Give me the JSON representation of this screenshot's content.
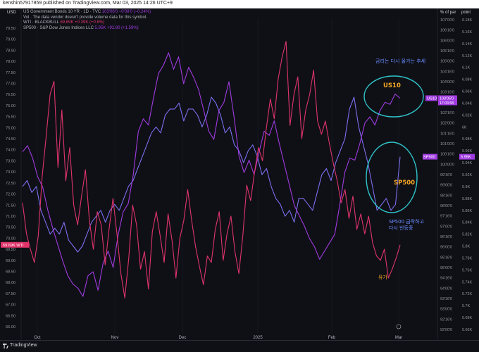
{
  "header": {
    "published_text": "kenshin57917859 published on TradingView.com, Mar 03, 2025 14:26 UTC+9",
    "left_axis_unit": "USD",
    "mid_axis_unit": "% of par",
    "right_axis_unit": "point"
  },
  "legend": {
    "line1_name": "US Government Bonds 10 YR · 1D · TVC",
    "line1_values": "103'06'0  −0'08'0 (−0.24%)",
    "line2": "Vol · The data vendor doesn't provide volume data for this symbol.",
    "line3_name": "WTI · BLACKBULL",
    "line3_values": "69.69K  +0.39K (+0.6%)",
    "line4_name": "SP500 · S&P Dow Jones Indices LLC",
    "line4_values": "5.95K  +92.80 (+1.59%)"
  },
  "footer": {
    "brand": "TradingView"
  },
  "colors": {
    "wti": "#e0346b",
    "us10": "#a03be0",
    "sp500": "#7b6ff0",
    "annotation_teal": "#2ec4c9",
    "annotation_orange": "#f5a623",
    "annotation_blue": "#6a8cff"
  },
  "chart_data": {
    "type": "line",
    "x_tick_labels": [
      "Oct",
      "Nov",
      "Dec",
      "2025",
      "Feb",
      "Mar"
    ],
    "left_axis": {
      "unit": "USD",
      "ylim": [
        66.0,
        79.5
      ],
      "ticks": [
        "79.50",
        "79.00",
        "78.50",
        "78.00",
        "77.50",
        "77.00",
        "76.50",
        "76.00",
        "75.50",
        "75.00",
        "74.50",
        "74.00",
        "73.50",
        "73.00",
        "72.50",
        "72.00",
        "71.50",
        "71.00",
        "70.50",
        "70.00",
        "69.50",
        "69.00",
        "68.50",
        "68.00",
        "67.50",
        "67.00",
        "66.50",
        "66.00"
      ]
    },
    "mid_axis": {
      "unit": "% of par",
      "ticks": [
        "107'00'0",
        "106'16'0",
        "106'00'0",
        "105'16'0",
        "105'00'0",
        "104'16'0",
        "104'00'0",
        "103'16'0",
        "103'00'0",
        "102'16'0",
        "102'00'0",
        "101'16'0",
        "101'00'0",
        "100'16'0",
        "100'00'0",
        "99'16'0",
        "99'00'0",
        "98'16'0",
        "98'00'0",
        "97'16'0",
        "97'00'0",
        "96'16'0",
        "96'00'0",
        "95'16'0",
        "95'00'0",
        "94'16'0",
        "94'00'0",
        "93'16'0",
        "93'00'0",
        "92'16'0",
        "92'00'0"
      ]
    },
    "right_axis": {
      "unit": "point",
      "ylim": [
        5.66,
        6.18
      ],
      "ticks": [
        "6.18K",
        "6.16K",
        "6.14K",
        "6.12K",
        "6.1K",
        "6.08K",
        "6.06K",
        "6.04K",
        "6.02K",
        "6K",
        "5.98K",
        "5.96K",
        "5.94K",
        "5.92K",
        "5.9K",
        "5.88K",
        "5.86K",
        "5.84K",
        "5.82K",
        "5.8K",
        "5.78K",
        "5.76K",
        "5.74K",
        "5.72K",
        "5.7K",
        "5.68K",
        "5.66K"
      ]
    },
    "price_labels": {
      "wti": "69.69K  WTI",
      "us10": "US10",
      "us10_price": "103'05'0",
      "us10_time": "17:03:58",
      "sp500": "SP500",
      "sp500_price": "5.95K"
    },
    "series": [
      {
        "name": "WTI",
        "axis": "left",
        "values": [
          71.6,
          70.2,
          69.5,
          68.9,
          70.1,
          72.8,
          74.6,
          76.5,
          77.1,
          73.2,
          75.8,
          72.6,
          74.1,
          71.5,
          70.6,
          71.9,
          73.1,
          70.8,
          69.5,
          71.2,
          70.6,
          68.8,
          70.4,
          71.8,
          70.2,
          68.4,
          67.3,
          69.1,
          71.5,
          70.6,
          68.6,
          69.4,
          67.7,
          70.3,
          71.2,
          70.1,
          68.9,
          71.1,
          69.9,
          68.2,
          70.0,
          70.8,
          72.2,
          70.8,
          69.6,
          68.7,
          67.9,
          69.2,
          68.9,
          70.4,
          71.2,
          69.0,
          70.2,
          71.0,
          69.4,
          68.4,
          70.1,
          72.4,
          71.7,
          73.0,
          74.1,
          73.5,
          75.0,
          76.3,
          75.4,
          77.2,
          78.2,
          78.9,
          75.1,
          76.5,
          77.3,
          74.5,
          75.8,
          76.5,
          77.6,
          75.3,
          74.7,
          75.3,
          74.3,
          73.4,
          72.6,
          71.6,
          72.2,
          70.9,
          71.9,
          70.4,
          71.1,
          70.2,
          71.0,
          69.8,
          69.2,
          69.0,
          69.5,
          68.2,
          68.6,
          69.1,
          69.7
        ],
        "note": "approximate daily closes, Sep 2024 – Mar 03 2025"
      },
      {
        "name": "US10",
        "axis": "mid",
        "values_pct_of_par": [
          100.6,
          100.9,
          100.3,
          99.4,
          98.9,
          97.8,
          96.9,
          96.1,
          95.3,
          94.6,
          94.2,
          94.0,
          93.6,
          94.6,
          94.8,
          93.9,
          95.2,
          95.8,
          95.0,
          96.6,
          97.7,
          98.1,
          99.5,
          101.6,
          102.2,
          101.9,
          103.2,
          104.4,
          104.8,
          105.4,
          104.6,
          105.2,
          103.9,
          104.7,
          104.2,
          103.6,
          102.6,
          101.6,
          101.2,
          102.6,
          103.0,
          104.0,
          102.3,
          100.4,
          99.6,
          100.2,
          99.5,
          100.6,
          101.6,
          101.4,
          102.1,
          101.0,
          100.0,
          99.0,
          98.0,
          97.5,
          97.0,
          96.4,
          96.0,
          95.4,
          95.8,
          96.2,
          96.6,
          98.0,
          99.6,
          100.3,
          100.2,
          101.0,
          102.0,
          102.3,
          101.9,
          102.6,
          103.0,
          102.9,
          103.4,
          103.2
        ],
        "note": "approximate daily closes, Sep 2024 – Mar 03 2025"
      },
      {
        "name": "SP500",
        "axis": "right",
        "values": [
          5.9,
          5.91,
          5.89,
          5.9,
          5.86,
          5.84,
          5.82,
          5.83,
          5.82,
          5.84,
          5.81,
          5.8,
          5.79,
          5.8,
          5.82,
          5.84,
          5.85,
          5.86,
          5.84,
          5.86,
          5.87,
          5.86,
          5.88,
          5.9,
          5.91,
          5.93,
          5.95,
          5.97,
          5.99,
          6.0,
          5.99,
          6.02,
          6.03,
          6.03,
          6.04,
          6.01,
          6.03,
          6.03,
          6.02,
          6.0,
          6.02,
          6.05,
          6.04,
          6.02,
          5.99,
          6.0,
          5.97,
          5.96,
          5.94,
          5.96,
          5.97,
          5.95,
          5.92,
          5.93,
          5.9,
          5.88,
          5.87,
          5.85,
          5.86,
          5.84,
          5.88,
          5.88,
          5.87,
          5.86,
          5.89,
          5.92,
          5.93,
          5.91,
          5.94,
          5.96,
          5.98,
          6.03,
          6.05,
          6.0,
          5.97,
          5.94,
          5.9,
          5.86,
          5.87,
          5.88,
          5.86,
          5.87,
          5.95
        ],
        "note": "approximate daily closes, Sep 2024 – Mar 03 2025"
      }
    ],
    "annotations": {
      "top_text": "금리는 다시 올가는 추세",
      "us10_label": "US10",
      "sp500_label": "SP500",
      "sp500_note_line1": "SP500 급락하고",
      "sp500_note_line2": "다시 반등중",
      "oil_label": "유가"
    }
  }
}
